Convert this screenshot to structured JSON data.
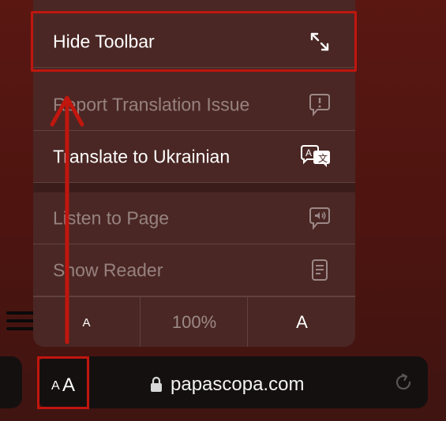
{
  "menu": {
    "items": [
      {
        "label": "Hide Toolbar",
        "icon": "resize-arrows-icon",
        "dim": false
      },
      {
        "label": "Report Translation Issue",
        "icon": "speech-bubble-exclamation-icon",
        "dim": true
      },
      {
        "label": "Translate to Ukrainian",
        "icon": "translate-icon",
        "dim": false
      },
      {
        "label": "Listen to Page",
        "icon": "speaker-bubble-icon",
        "dim": true
      },
      {
        "label": "Show Reader",
        "icon": "reader-document-icon",
        "dim": true
      }
    ],
    "font_size": {
      "smaller": "A",
      "zoom": "100%",
      "larger": "A"
    }
  },
  "toolbar": {
    "aa_small": "A",
    "aa_large": "A",
    "url": "papascopa.com",
    "lock_icon": "lock-icon",
    "reload_icon": "reload-icon"
  },
  "colors": {
    "highlight": "#c0160e",
    "menu_bg": "#4a2724"
  }
}
